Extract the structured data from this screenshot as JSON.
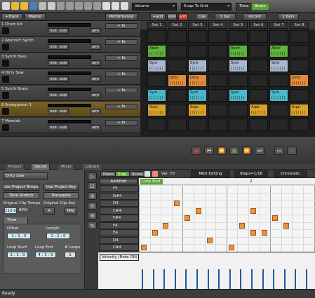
{
  "toolbar": {
    "volume_select": "Volume",
    "snap_select": "Snap To Grid",
    "time_label": "Time",
    "beats_label": "Beats"
  },
  "session_header": {
    "add_track": "+Track",
    "master": "Master",
    "performance": "Performance",
    "add_btn": "+add",
    "solo_btn": "solo",
    "arm_btn": "arm",
    "cue_btn": "cue",
    "bar_select": "1 bar",
    "record_select": "record",
    "bars_select": "2 bars",
    "sets": [
      "Set 1",
      "Set 2",
      "Set 3",
      "Set 4",
      "Set 5",
      "Set 6",
      "Set 7",
      "Set 8"
    ]
  },
  "tracks": [
    {
      "name": "1 Drum Kit",
      "selected": false
    },
    {
      "name": "2 Abstract Synth",
      "selected": false
    },
    {
      "name": "3 Synth Bass",
      "selected": false
    },
    {
      "name": "4 Dirty Saw",
      "selected": false
    },
    {
      "name": "5 Synth Brass",
      "selected": false
    },
    {
      "name": "6 Arpeggiator 1",
      "selected": true
    },
    {
      "name": "7 Messiah",
      "selected": false
    }
  ],
  "track_controls": {
    "mute": "mute",
    "solo": "solo",
    "arm": "arm",
    "fx": "+ fx"
  },
  "clips": [
    {
      "row": 1,
      "col": 0,
      "label": "Abstr",
      "color": "#5fb33c"
    },
    {
      "row": 1,
      "col": 4,
      "label": "Abstr",
      "color": "#5fb33c"
    },
    {
      "row": 1,
      "col": 6,
      "label": "Abstr",
      "color": "#5fb33c"
    },
    {
      "row": 2,
      "col": 0,
      "label": "Synt",
      "color": "#a9b7cf"
    },
    {
      "row": 2,
      "col": 2,
      "label": "Synt",
      "color": "#a9b7cf"
    },
    {
      "row": 2,
      "col": 4,
      "label": "Synt",
      "color": "#a9b7cf"
    },
    {
      "row": 2,
      "col": 6,
      "label": "Synt",
      "color": "#a9b7cf"
    },
    {
      "row": 3,
      "col": 1,
      "label": "Dirty",
      "color": "#e08c3a"
    },
    {
      "row": 3,
      "col": 2,
      "label": "Dirty",
      "color": "#e08c3a"
    },
    {
      "row": 3,
      "col": 7,
      "label": "Dirty",
      "color": "#e08c3a"
    },
    {
      "row": 4,
      "col": 0,
      "label": "Synt",
      "color": "#4bb7c9"
    },
    {
      "row": 4,
      "col": 2,
      "label": "Synt",
      "color": "#4bb7c9"
    },
    {
      "row": 4,
      "col": 4,
      "label": "Synt",
      "color": "#4bb7c9"
    },
    {
      "row": 4,
      "col": 6,
      "label": "Synt",
      "color": "#4bb7c9"
    },
    {
      "row": 5,
      "col": 0,
      "label": "Arpe",
      "color": "#d9a12a"
    },
    {
      "row": 5,
      "col": 2,
      "label": "Arpe",
      "color": "#d9a12a"
    },
    {
      "row": 5,
      "col": 5,
      "label": "Arpe",
      "color": "#d9a12a"
    },
    {
      "row": 5,
      "col": 7,
      "label": "Arpe",
      "color": "#d9a12a"
    }
  ],
  "bottom_tabs": [
    "Project",
    "Sound",
    "Mixer",
    "Library"
  ],
  "sound_panel": {
    "instrument": "Dirty Saw",
    "use_project_tempo": "Use Project Tempo",
    "use_project_key": "Use Project Key",
    "time_stretch": "Time Stretch",
    "transpose": "Transpose",
    "orig_tempo_label": "Original Clip Tempo",
    "orig_key_label": "Original Clip Key",
    "tempo_value": "110.0",
    "bpm": "BPM",
    "key_value": "A",
    "key_mode": "MAJ",
    "time_tab": "Time",
    "offset_label": "Offset",
    "offset_value": "1 : 1 : 0",
    "length_label": "Length",
    "length_value": "1 : 1 : 0",
    "loop_start_label": "Loop Start",
    "loop_start_value": "1 : 1 : 0",
    "loop_end_label": "Loop End",
    "loop_end_value": "4 : 1 : 0",
    "loops_label": "# Loops",
    "loops_value": "1"
  },
  "piano_toolbar": {
    "piano": "Piano",
    "step": "Step",
    "score": "Score",
    "vel": "Vel: 70",
    "midi_editing": "MIDI Editing",
    "steps": "Steps=1/16",
    "scale": "Chromatic",
    "add_edit": "Add/Edit",
    "marker_start": "Loop Start",
    "marker_2": "2"
  },
  "keys": [
    "F5",
    "D#4",
    "D4",
    "C#4",
    "F#4",
    "F4",
    "E4",
    "D4",
    "C#4"
  ],
  "notes": [
    {
      "r": 1,
      "c": 3
    },
    {
      "r": 2,
      "c": 5
    },
    {
      "r": 2,
      "c": 10
    },
    {
      "r": 3,
      "c": 4
    },
    {
      "r": 3,
      "c": 12
    },
    {
      "r": 4,
      "c": 2
    },
    {
      "r": 4,
      "c": 9
    },
    {
      "r": 4,
      "c": 13
    },
    {
      "r": 5,
      "c": 1
    },
    {
      "r": 5,
      "c": 10
    },
    {
      "r": 5,
      "c": 11
    },
    {
      "r": 6,
      "c": 6
    },
    {
      "r": 7,
      "c": 0
    },
    {
      "r": 7,
      "c": 8
    }
  ],
  "velocity_label": "Velocity (Note ON)",
  "status": "Ready"
}
